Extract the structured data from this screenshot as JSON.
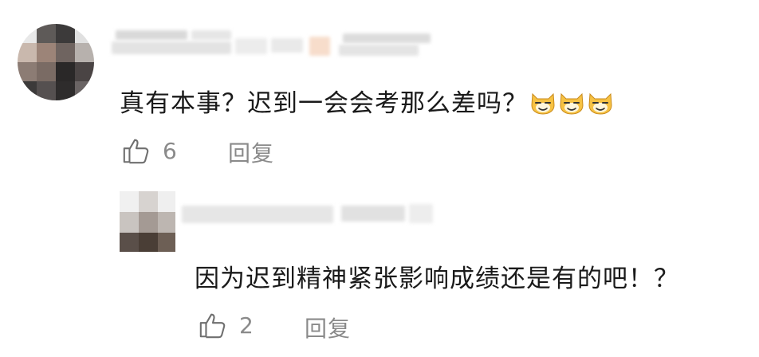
{
  "comment": {
    "text": "真有本事？迟到一会会考那么差吗？",
    "emoji_icon": "grinning-cat-face-emoji",
    "emoji_count": 3,
    "likes": "6",
    "reply_label": "回复"
  },
  "reply": {
    "text": "因为迟到精神紧张影响成绩还是有的吧！？",
    "likes": "2",
    "reply_label": "回复"
  },
  "colors": {
    "text": "#1a1a1a",
    "muted": "#8a8a8a",
    "emoji_fill": "#f6c244",
    "background": "#ffffff"
  }
}
